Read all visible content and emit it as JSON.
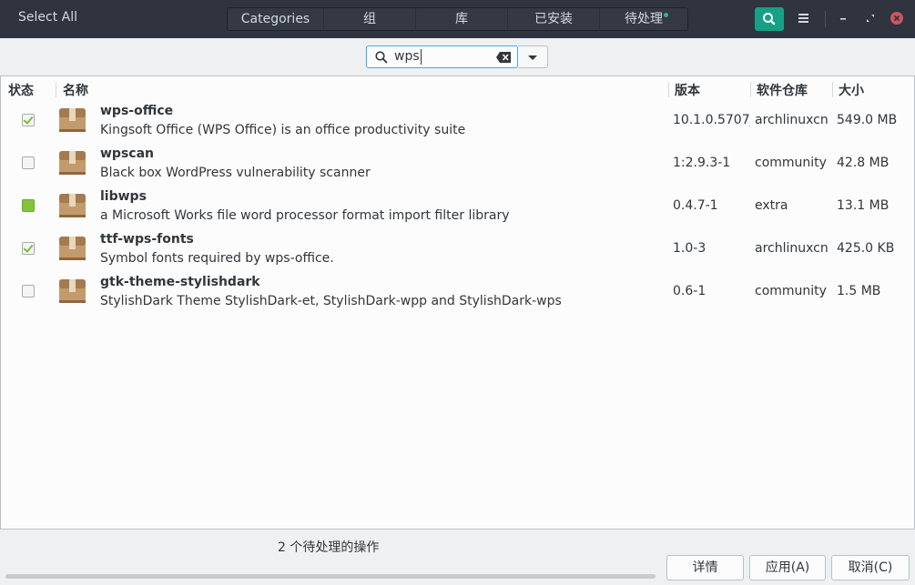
{
  "header": {
    "select_all": "Select All",
    "tabs": [
      {
        "label": "Categories"
      },
      {
        "label": "组"
      },
      {
        "label": "库"
      },
      {
        "label": "已安装"
      },
      {
        "label": "待处理"
      }
    ],
    "pending_indicator_color": "#2eb398",
    "accent_color": "#16a085",
    "icons": [
      "search-icon",
      "hamburger-menu-icon",
      "minimize-icon",
      "restore-icon",
      "close-icon"
    ]
  },
  "search": {
    "value": "wps",
    "icons": [
      "search-icon",
      "clear-text-icon",
      "dropdown-caret-icon"
    ]
  },
  "table": {
    "columns": {
      "status": "状态",
      "name": "名称",
      "version": "版本",
      "repo": "软件仓库",
      "size": "大小"
    },
    "rows": [
      {
        "name": "wps-office",
        "description": "Kingsoft Office (WPS Office) is an office productivity suite",
        "version": "10.1.0.5707_",
        "repo": "archlinuxcn",
        "size": "549.0 MB",
        "status": "to-install"
      },
      {
        "name": "wpscan",
        "description": "Black box WordPress vulnerability scanner",
        "version": "1:2.9.3-1",
        "repo": "community",
        "size": "42.8 MB",
        "status": "not-installed"
      },
      {
        "name": "libwps",
        "description": "a Microsoft Works file word processor format import filter library",
        "version": "0.4.7-1",
        "repo": "extra",
        "size": "13.1 MB",
        "status": "installed"
      },
      {
        "name": "ttf-wps-fonts",
        "description": "Symbol fonts required by wps-office.",
        "version": "1.0-3",
        "repo": "archlinuxcn",
        "size": "425.0 KB",
        "status": "to-install"
      },
      {
        "name": "gtk-theme-stylishdark",
        "description": "StylishDark Theme StylishDark-et, StylishDark-wpp and StylishDark-wps",
        "version": "0.6-1",
        "repo": "community",
        "size": "1.5 MB",
        "status": "not-installed"
      }
    ]
  },
  "footer": {
    "pending_text": "2 个待处理的操作",
    "progress_fraction": 0,
    "buttons": {
      "details": "详情",
      "apply": "应用(A)",
      "cancel": "取消(C)"
    }
  }
}
